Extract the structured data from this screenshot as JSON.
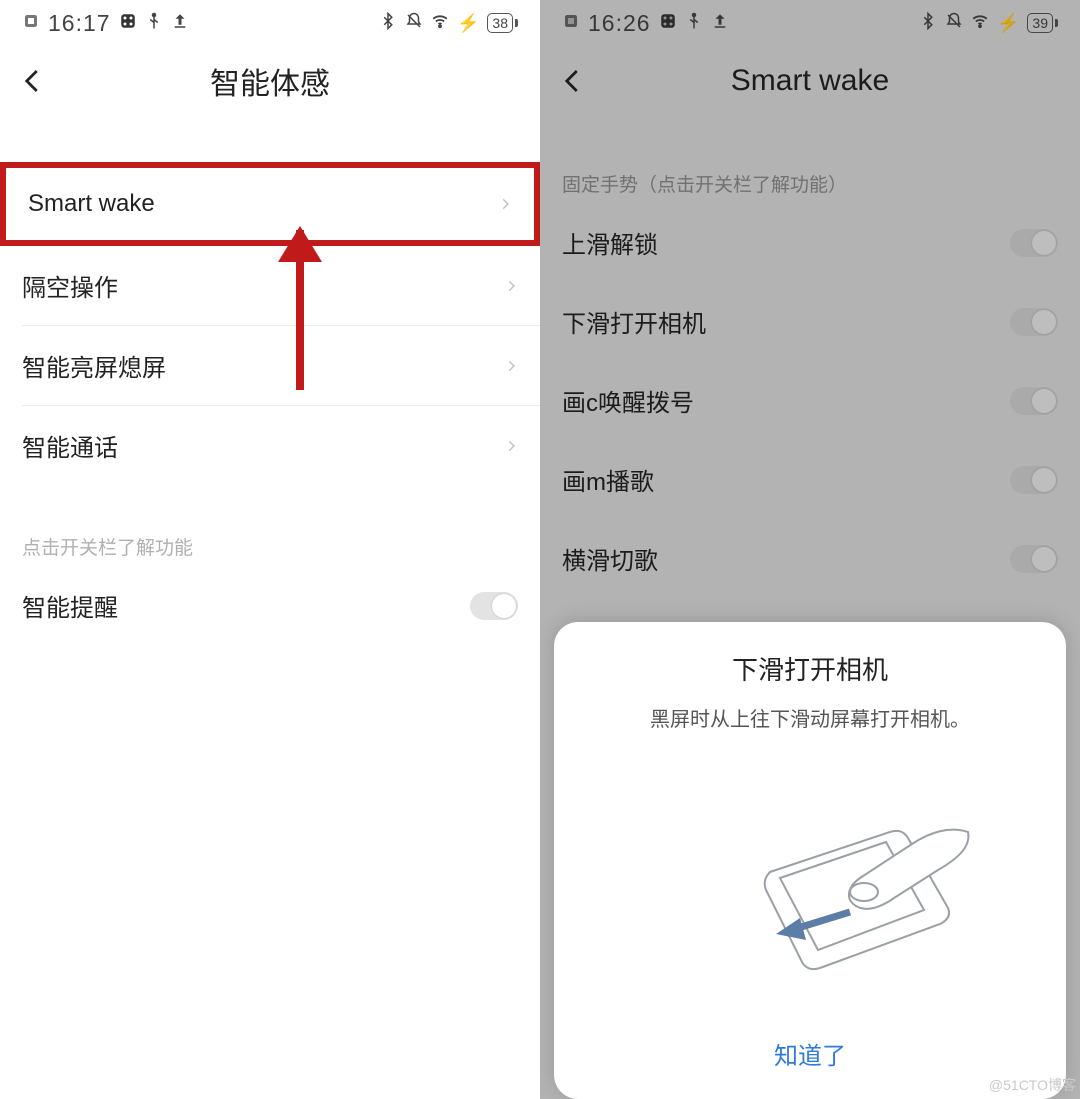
{
  "watermark": "@51CTO博客",
  "left": {
    "status": {
      "time": "16:17",
      "battery": "38"
    },
    "title": "智能体感",
    "rows": {
      "smart_wake": "Smart wake",
      "air_gesture": "隔空操作",
      "smart_screen": "智能亮屏熄屏",
      "smart_call": "智能通话"
    },
    "section_caption": "点击开关栏了解功能",
    "reminder": "智能提醒"
  },
  "right": {
    "status": {
      "time": "16:26",
      "battery": "39"
    },
    "title": "Smart wake",
    "section_caption": "固定手势（点击开关栏了解功能）",
    "rows": {
      "swipe_up_unlock": "上滑解锁",
      "swipe_down_camera": "下滑打开相机",
      "draw_c_dial": "画c唤醒拨号",
      "draw_m_music": "画m播歌",
      "horizontal_song": "横滑切歌"
    },
    "modal": {
      "title": "下滑打开相机",
      "desc": "黑屏时从上往下滑动屏幕打开相机。",
      "ack": "知道了"
    }
  }
}
